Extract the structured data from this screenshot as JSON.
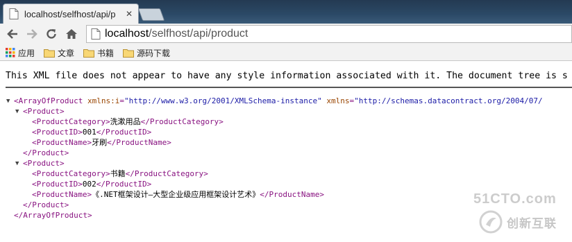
{
  "browser": {
    "tab": {
      "title": "localhost/selfhost/api/p"
    },
    "url": {
      "host": "localhost",
      "path": "/selfhost/api/product"
    },
    "bookmarks": [
      {
        "label": "应用",
        "icon": "apps-grid-icon"
      },
      {
        "label": "文章",
        "icon": "folder-icon"
      },
      {
        "label": "书籍",
        "icon": "folder-icon"
      },
      {
        "label": "源码下载",
        "icon": "folder-icon"
      }
    ]
  },
  "page": {
    "notice": "This XML file does not appear to have any style information associated with it. The document tree is s",
    "xml": {
      "root_open_tag": "ArrayOfProduct",
      "ns1_name": "xmlns:i",
      "ns1_value": "\"http://www.w3.org/2001/XMLSchema-instance\"",
      "ns2_name": "xmlns",
      "ns2_value": "\"http://schemas.datacontract.org/2004/07/",
      "product_tag": "Product",
      "category_tag": "ProductCategory",
      "id_tag": "ProductID",
      "name_tag": "ProductName",
      "products": [
        {
          "category": "洗漱用品",
          "id": "001",
          "name": "牙刷"
        },
        {
          "category": "书籍",
          "id": "002",
          "name": "《.NET框架设计—大型企业级应用框架设计艺术》"
        }
      ]
    }
  },
  "watermark": {
    "line1": "51CTO.com",
    "line2": "创新互联"
  },
  "colors": {
    "tag": "#881280",
    "attribute": "#994500",
    "value": "#1a1aa6"
  }
}
